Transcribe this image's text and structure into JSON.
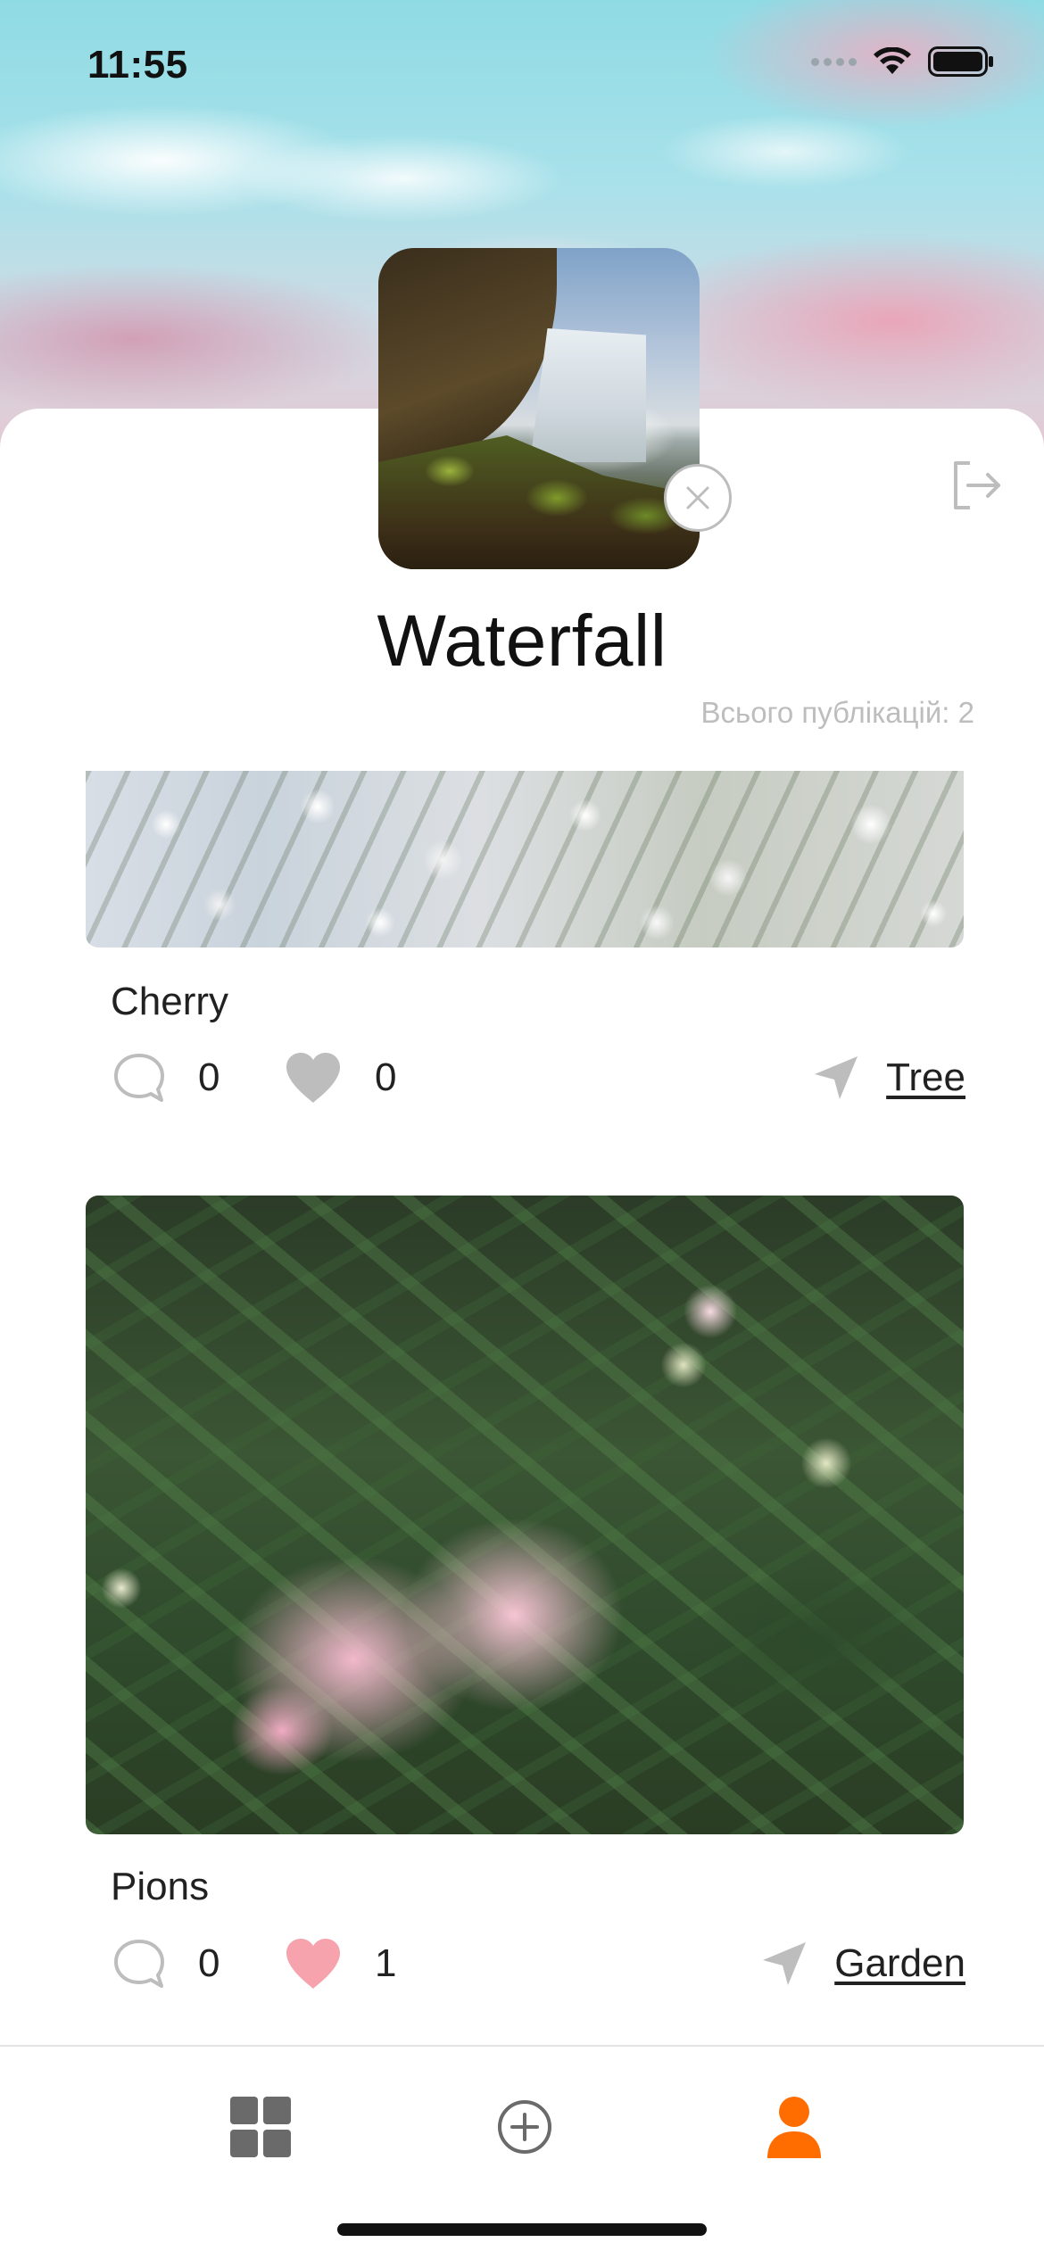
{
  "status_bar": {
    "time": "11:55"
  },
  "profile": {
    "name": "Waterfall",
    "posts_count_text": "Всього публікацій: 2",
    "avatar_icon": "avatar-photo-waterfall",
    "remove_avatar_icon": "close-icon",
    "logout_icon": "logout-icon"
  },
  "posts": [
    {
      "title": "Cherry",
      "comments": "0",
      "likes": "0",
      "liked": false,
      "location": "Tree"
    },
    {
      "title": "Pions",
      "comments": "0",
      "likes": "1",
      "liked": true,
      "location": "Garden"
    }
  ],
  "tab_bar": {
    "tabs": [
      {
        "icon": "grid-icon",
        "active": false
      },
      {
        "icon": "plus-circle-icon",
        "active": false
      },
      {
        "icon": "user-icon",
        "active": true
      }
    ]
  },
  "colors": {
    "accent": "#FF6C00",
    "icon_gray": "#BDBDBD",
    "like_active": "#F6A3AD",
    "text": "#212121"
  }
}
